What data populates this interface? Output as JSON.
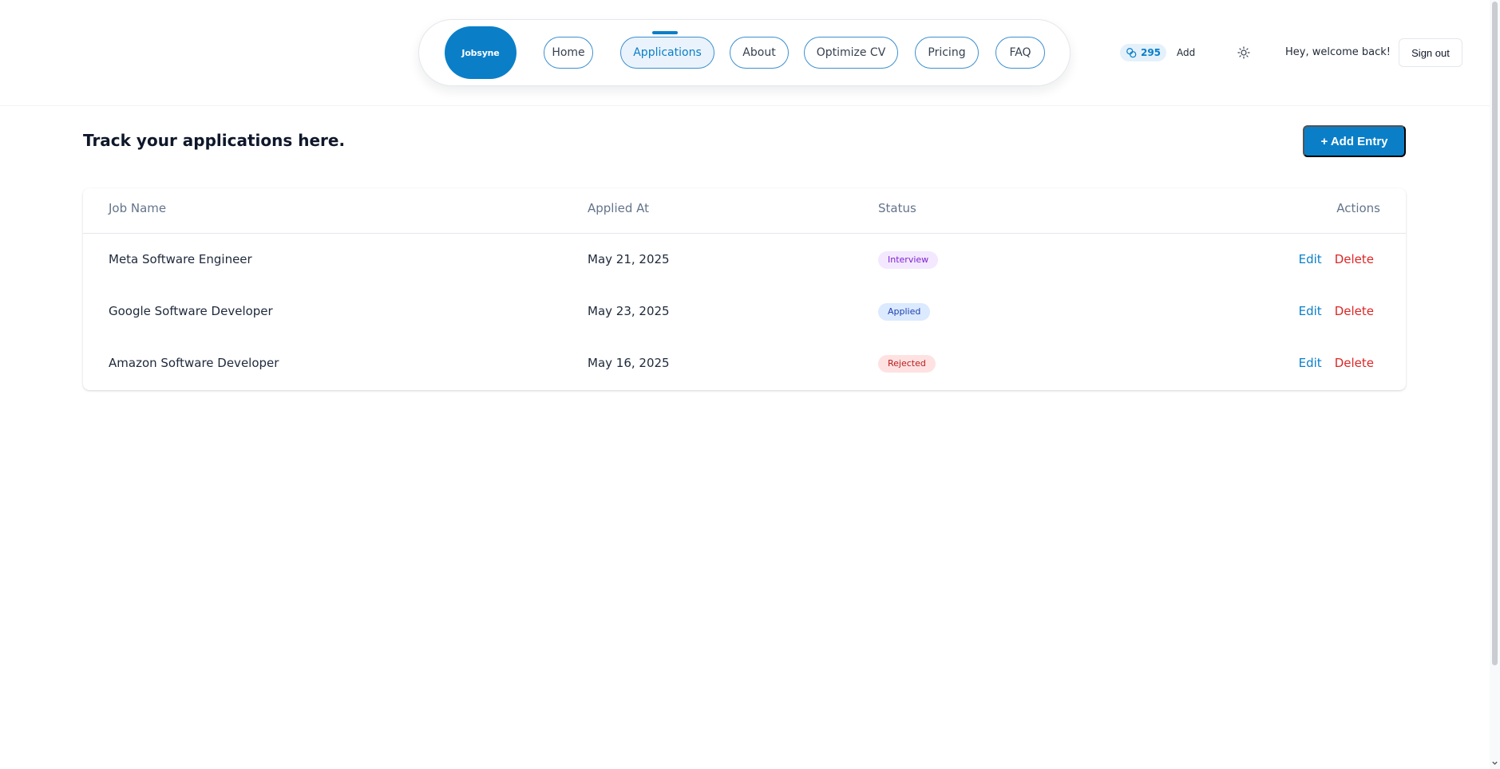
{
  "header": {
    "logo_text": "Jobsyne",
    "nav": [
      {
        "label": "Home",
        "active": false
      },
      {
        "label": "Applications",
        "active": true
      },
      {
        "label": "About",
        "active": false
      },
      {
        "label": "Optimize CV",
        "active": false
      },
      {
        "label": "Pricing",
        "active": false
      },
      {
        "label": "FAQ",
        "active": false
      }
    ],
    "credits": "295",
    "add_credits_label": "Add",
    "welcome_text": "Hey, welcome back!",
    "signout_label": "Sign out",
    "icons": {
      "credits": "coins-icon",
      "theme": "sun-icon"
    }
  },
  "main": {
    "heading": "Track your applications here.",
    "add_entry_label": "+ Add Entry",
    "table": {
      "columns": [
        "Job Name",
        "Applied At",
        "Status",
        "Actions"
      ],
      "rows": [
        {
          "job": "Meta Software Engineer",
          "date": "May 21, 2025",
          "status": "Interview",
          "status_kind": "interview",
          "edit": "Edit",
          "delete": "Delete"
        },
        {
          "job": "Google Software Developer",
          "date": "May 23, 2025",
          "status": "Applied",
          "status_kind": "applied",
          "edit": "Edit",
          "delete": "Delete"
        },
        {
          "job": "Amazon Software Developer",
          "date": "May 16, 2025",
          "status": "Rejected",
          "status_kind": "rejected",
          "edit": "Edit",
          "delete": "Delete"
        }
      ]
    }
  },
  "colors": {
    "brand": "#0a7fc8",
    "delete": "#dc2626",
    "interview_bg": "#f3e8ff",
    "applied_bg": "#dbeafe",
    "rejected_bg": "#fee2e2"
  }
}
